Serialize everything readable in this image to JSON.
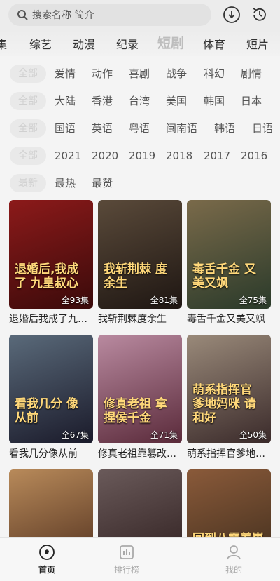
{
  "search": {
    "placeholder": "搜索名称 简介"
  },
  "icons": {
    "search": "search-icon",
    "download": "download-icon",
    "history": "history-icon"
  },
  "tabs": [
    "集",
    "综艺",
    "动漫",
    "纪录",
    "短剧",
    "体育",
    "短片"
  ],
  "active_tab": "短剧",
  "filters": [
    {
      "selected": "全部",
      "options": [
        "爱情",
        "动作",
        "喜剧",
        "战争",
        "科幻",
        "剧情"
      ]
    },
    {
      "selected": "全部",
      "options": [
        "大陆",
        "香港",
        "台湾",
        "美国",
        "韩国",
        "日本"
      ]
    },
    {
      "selected": "全部",
      "options": [
        "国语",
        "英语",
        "粤语",
        "闽南语",
        "韩语",
        "日语"
      ]
    },
    {
      "selected": "全部",
      "options": [
        "2021",
        "2020",
        "2019",
        "2018",
        "2017",
        "2016"
      ]
    },
    {
      "selected": "最新",
      "options": [
        "最热",
        "最赞"
      ]
    }
  ],
  "cards": [
    {
      "title": "退婚后我成了九…",
      "episodes": "全93集",
      "art": "退婚后,我成了 九皇叔心",
      "c1": "#8c1a1a",
      "c2": "#3a0a0a"
    },
    {
      "title": "我斩荆棘度余生",
      "episodes": "全81集",
      "art": "我斩荆棘 度余生",
      "c1": "#5a4a3a",
      "c2": "#1e1612"
    },
    {
      "title": "毒舌千金又美又飒",
      "episodes": "全75集",
      "art": "毒舌千金 又美又飒",
      "c1": "#7a6a4a",
      "c2": "#2a3a2a"
    },
    {
      "title": "看我几分像从前",
      "episodes": "全67集",
      "art": "看我几分 像从前",
      "c1": "#5a6a7a",
      "c2": "#1a1a2a"
    },
    {
      "title": "修真老祖靠篡改…",
      "episodes": "全71集",
      "art": "修真老祖 拿捏侯千金",
      "c1": "#b98aa0",
      "c2": "#5a2a3a"
    },
    {
      "title": "萌系指挥官爹地…",
      "episodes": "全50集",
      "art": "萌系指挥官 爹地妈咪 请和好",
      "c1": "#9a8a7a",
      "c2": "#3a2a2a"
    },
    {
      "title": "",
      "episodes": "",
      "art": "",
      "c1": "#b88a5a",
      "c2": "#4a2a1a"
    },
    {
      "title": "",
      "episodes": "",
      "art": "",
      "c1": "#6a5a5a",
      "c2": "#2a1a1a"
    },
    {
      "title": "",
      "episodes": "",
      "art": "回到八零养崽崽",
      "c1": "#8a5a3a",
      "c2": "#3a2a1a"
    }
  ],
  "nav": [
    {
      "label": "首页",
      "icon": "football-icon",
      "active": true
    },
    {
      "label": "排行榜",
      "icon": "chart-icon",
      "active": false
    },
    {
      "label": "我的",
      "icon": "user-icon",
      "active": false
    }
  ]
}
